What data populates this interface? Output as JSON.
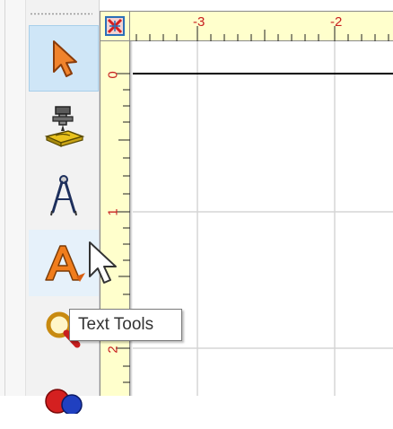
{
  "rulers": {
    "top_labels": [
      "-3",
      "-2"
    ],
    "left_labels": [
      "0",
      "1",
      "2"
    ],
    "label_color": "#c82020",
    "background": "#ffffcc"
  },
  "toolbar": {
    "tools": [
      {
        "name": "select-tool",
        "icon": "arrow-pointer-icon",
        "state": "selected"
      },
      {
        "name": "machine-tool",
        "icon": "cnc-router-icon",
        "state": "normal"
      },
      {
        "name": "drafting-tool",
        "icon": "compass-icon",
        "state": "normal"
      },
      {
        "name": "text-tool",
        "icon": "text-tools-icon",
        "state": "hover"
      },
      {
        "name": "zoom-tool",
        "icon": "magnifier-icon",
        "state": "normal"
      },
      {
        "name": "shapes-tool",
        "icon": "shapes-icon",
        "state": "normal"
      }
    ],
    "selected_color": "#cfe6f7"
  },
  "tooltip": {
    "text": "Text Tools"
  },
  "canvas": {
    "grid_color": "#d6d6d6"
  }
}
